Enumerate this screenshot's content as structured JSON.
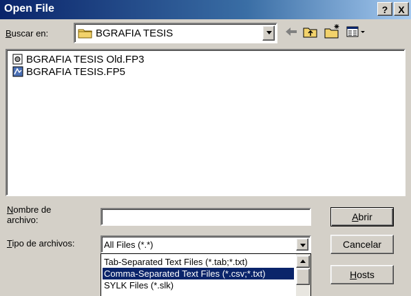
{
  "window": {
    "title": "Open File",
    "help_label": "?",
    "close_label": "X"
  },
  "lookin": {
    "label_ul": "B",
    "label_rest": "uscar en:",
    "folder": "BGRAFIA TESIS"
  },
  "files": [
    {
      "name": "BGRAFIA TESIS Old.FP3",
      "icon": "fp3-file-icon"
    },
    {
      "name": "BGRAFIA TESIS.FP5",
      "icon": "fp5-file-icon"
    }
  ],
  "filename": {
    "label_ul": "N",
    "label_rest": "ombre de",
    "label_line2": "archivo:",
    "value": ""
  },
  "filetype": {
    "label_ul": "T",
    "label_rest": "ipo de archivos:",
    "value": "All Files (*.*)",
    "options": [
      "Tab-Separated Text Files (*.tab;*.txt)",
      "Comma-Separated Text Files (*.csv;*.txt)",
      "SYLK Files (*.slk)"
    ],
    "selected_index": 1
  },
  "buttons": {
    "open_ul": "A",
    "open_rest": "brir",
    "cancel": "Cancelar",
    "hosts_ul": "H",
    "hosts_rest": "osts"
  }
}
